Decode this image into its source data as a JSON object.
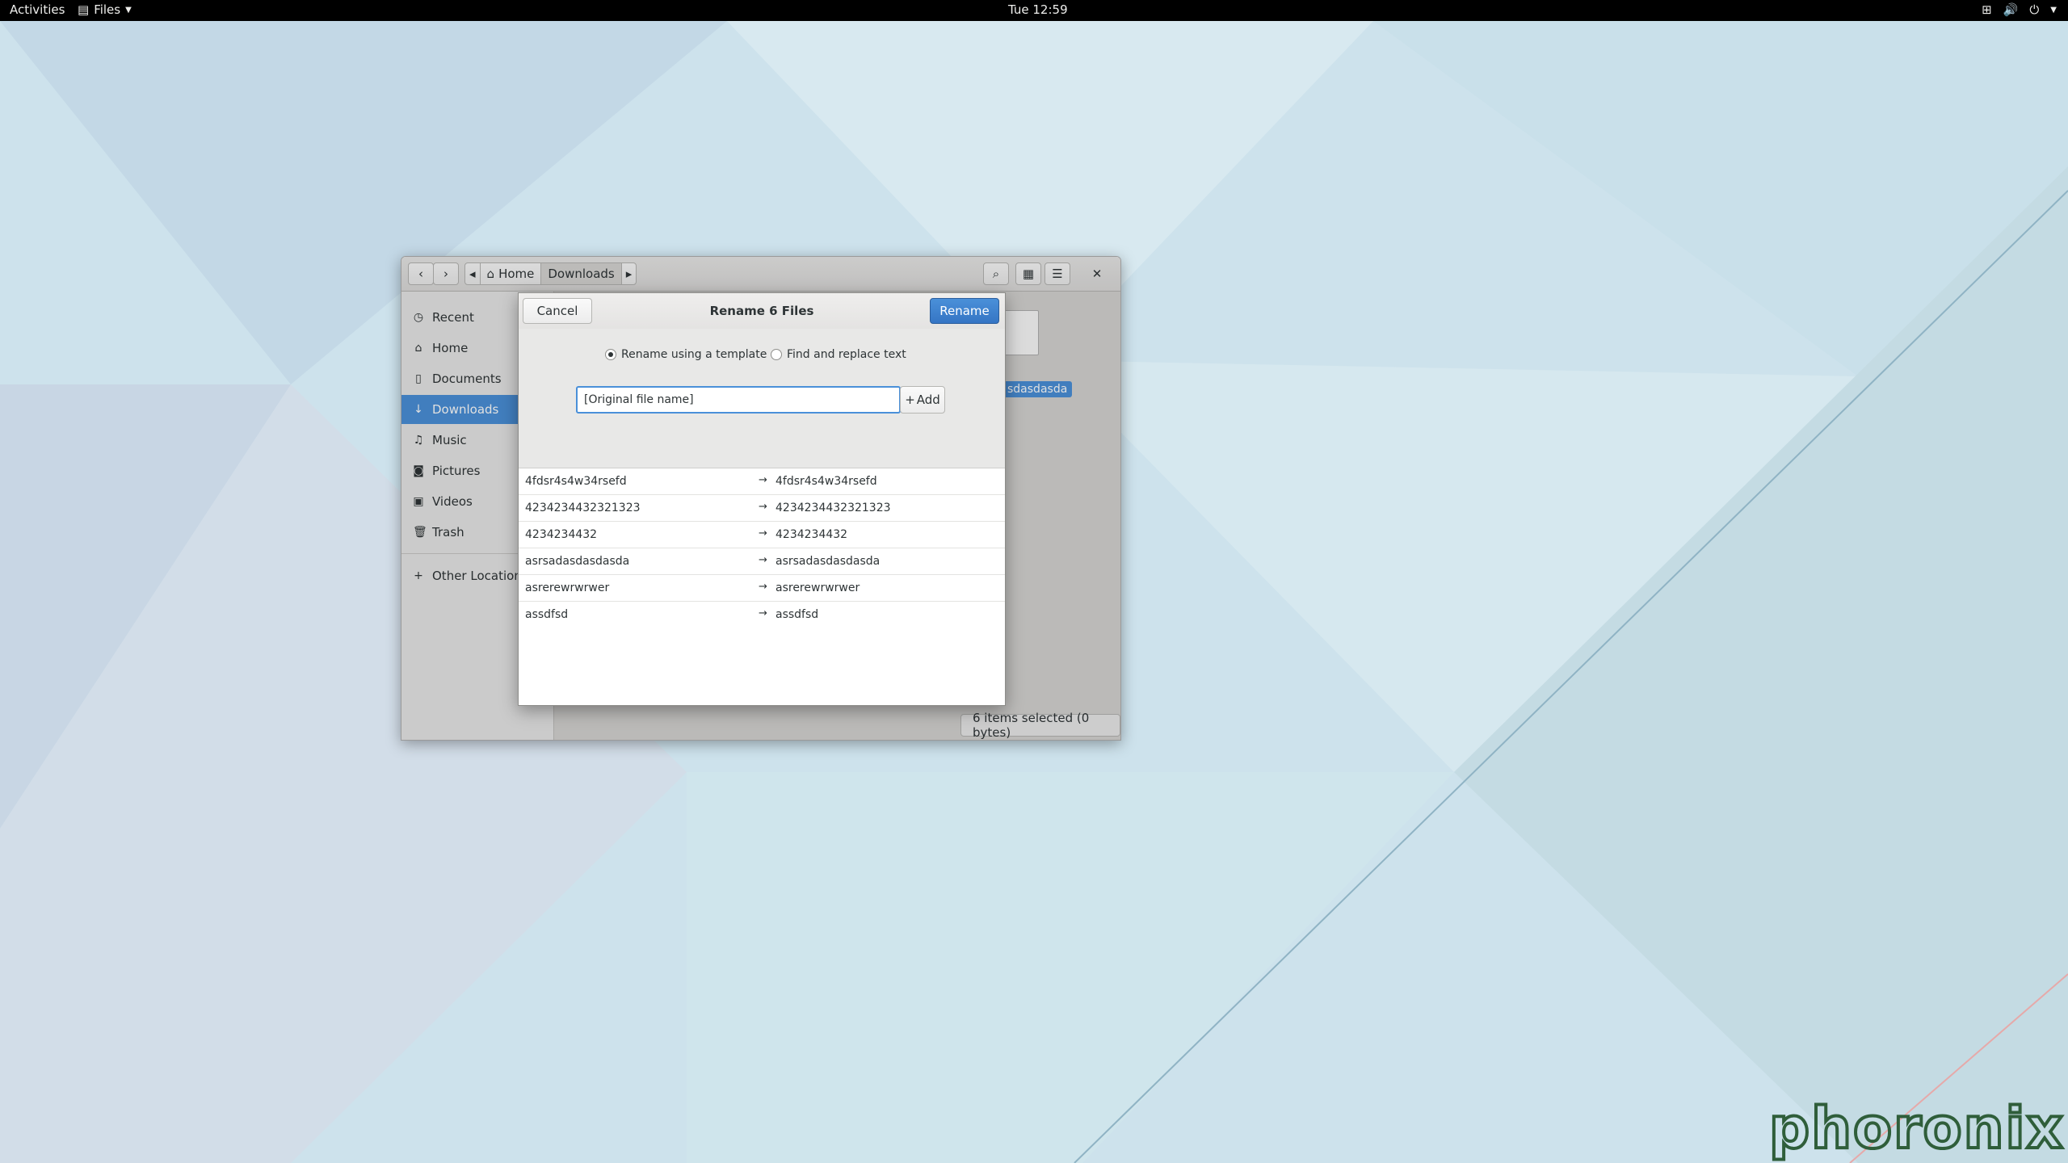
{
  "topbar": {
    "activities": "Activities",
    "app_menu": "Files",
    "clock": "Tue 12:59"
  },
  "window": {
    "pathbar": [
      "Home",
      "Downloads"
    ],
    "sidebar": [
      {
        "label": "Recent",
        "icon": "clock-icon"
      },
      {
        "label": "Home",
        "icon": "home-icon"
      },
      {
        "label": "Documents",
        "icon": "document-icon"
      },
      {
        "label": "Downloads",
        "icon": "download-icon",
        "selected": true
      },
      {
        "label": "Music",
        "icon": "music-icon"
      },
      {
        "label": "Pictures",
        "icon": "camera-icon"
      },
      {
        "label": "Videos",
        "icon": "film-icon"
      },
      {
        "label": "Trash",
        "icon": "trash-icon"
      },
      {
        "label": "Other Locations",
        "icon": "plus-icon"
      }
    ],
    "file_label": "sdasdasda",
    "status": "6 items selected (0 bytes)"
  },
  "dialog": {
    "title": "Rename 6 Files",
    "cancel": "Cancel",
    "rename": "Rename",
    "option_template": "Rename using a template",
    "option_replace": "Find and replace text",
    "template_value": "[Original file name]",
    "add": "Add",
    "rows": [
      {
        "old": "4fdsr4s4w34rsefd",
        "new": "4fdsr4s4w34rsefd"
      },
      {
        "old": "4234234432321323",
        "new": "4234234432321323"
      },
      {
        "old": "4234234432",
        "new": "4234234432"
      },
      {
        "old": "asrsadasdasdasda",
        "new": "asrsadasdasdasda"
      },
      {
        "old": "asrerewrwrwer",
        "new": "asrerewrwrwer"
      },
      {
        "old": "assdfsd",
        "new": "assdfsd"
      }
    ]
  },
  "watermark": "phoronix"
}
